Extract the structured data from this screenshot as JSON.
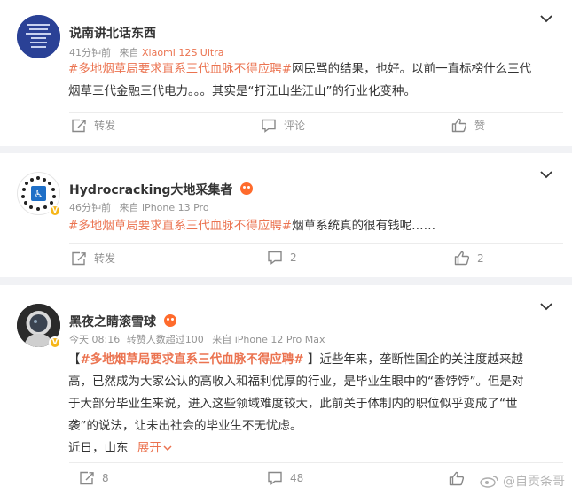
{
  "posts": [
    {
      "user": "说南讲北话东西",
      "time": "41分钟前",
      "from_prefix": "来自",
      "source": "Xiaomi 12S Ultra",
      "avatar_text": [
        "营南北讲到",
        "话东西",
        "你听到了吗西",
        "那些话",
        "说北京",
        "讲北西东"
      ],
      "body_topic": "#多地烟草局要求直系三代血脉不得应聘#",
      "body_line1_rest": "网民骂的结果，也好。以前一直标榜什么三代",
      "body_line2": "烟草三代金融三代电力。。。其实是“打江山坐江山”的行业化变种。",
      "actions": {
        "repost": "转发",
        "comment": "评论",
        "like": "赞"
      }
    },
    {
      "user": "Hydrocracking大地采集者",
      "time": "46分钟前",
      "from_prefix": "来自",
      "source": "iPhone 13 Pro",
      "body_topic": "#多地烟草局要求直系三代血脉不得应聘#",
      "body_rest": "烟草系统真的很有钱呢……",
      "actions": {
        "repost": "转发",
        "comment": "2",
        "like": "2"
      }
    },
    {
      "user": "黑夜之睛滚雪球",
      "time": "今天 08:16",
      "reposts": "转赞人数超过100",
      "from_prefix": "来自",
      "source": "iPhone 12 Pro Max",
      "body_open": "【",
      "body_topic": "#多地烟草局要求直系三代血脉不得应聘#",
      "body_close_and_l1": " 】近些年来，垄断性国企的关注度越来越",
      "body_line2": "高，已然成为大家公认的高收入和福利优厚的行业，是毕业生眼中的“香饽饽”。但是对",
      "body_line3": "于大部分毕业生来说，进入这些领域难度较大，此前关于体制内的职位似乎变成了“世",
      "body_line4": "袭”的说法，让未出社会的毕业生不无忧虑。",
      "body_line5": "近日，山东",
      "expand": "展开",
      "actions": {
        "repost": "8",
        "comment": "48",
        "like": ""
      }
    }
  ],
  "watermark": "@自贡条哥",
  "colors": {
    "accent": "#eb7350",
    "meta": "#939393",
    "background": "#f1f2f5"
  },
  "icons": [
    "chevron-down-icon",
    "repost-icon",
    "comment-icon",
    "like-icon",
    "vip-badge-icon",
    "weibo-logo-icon"
  ]
}
